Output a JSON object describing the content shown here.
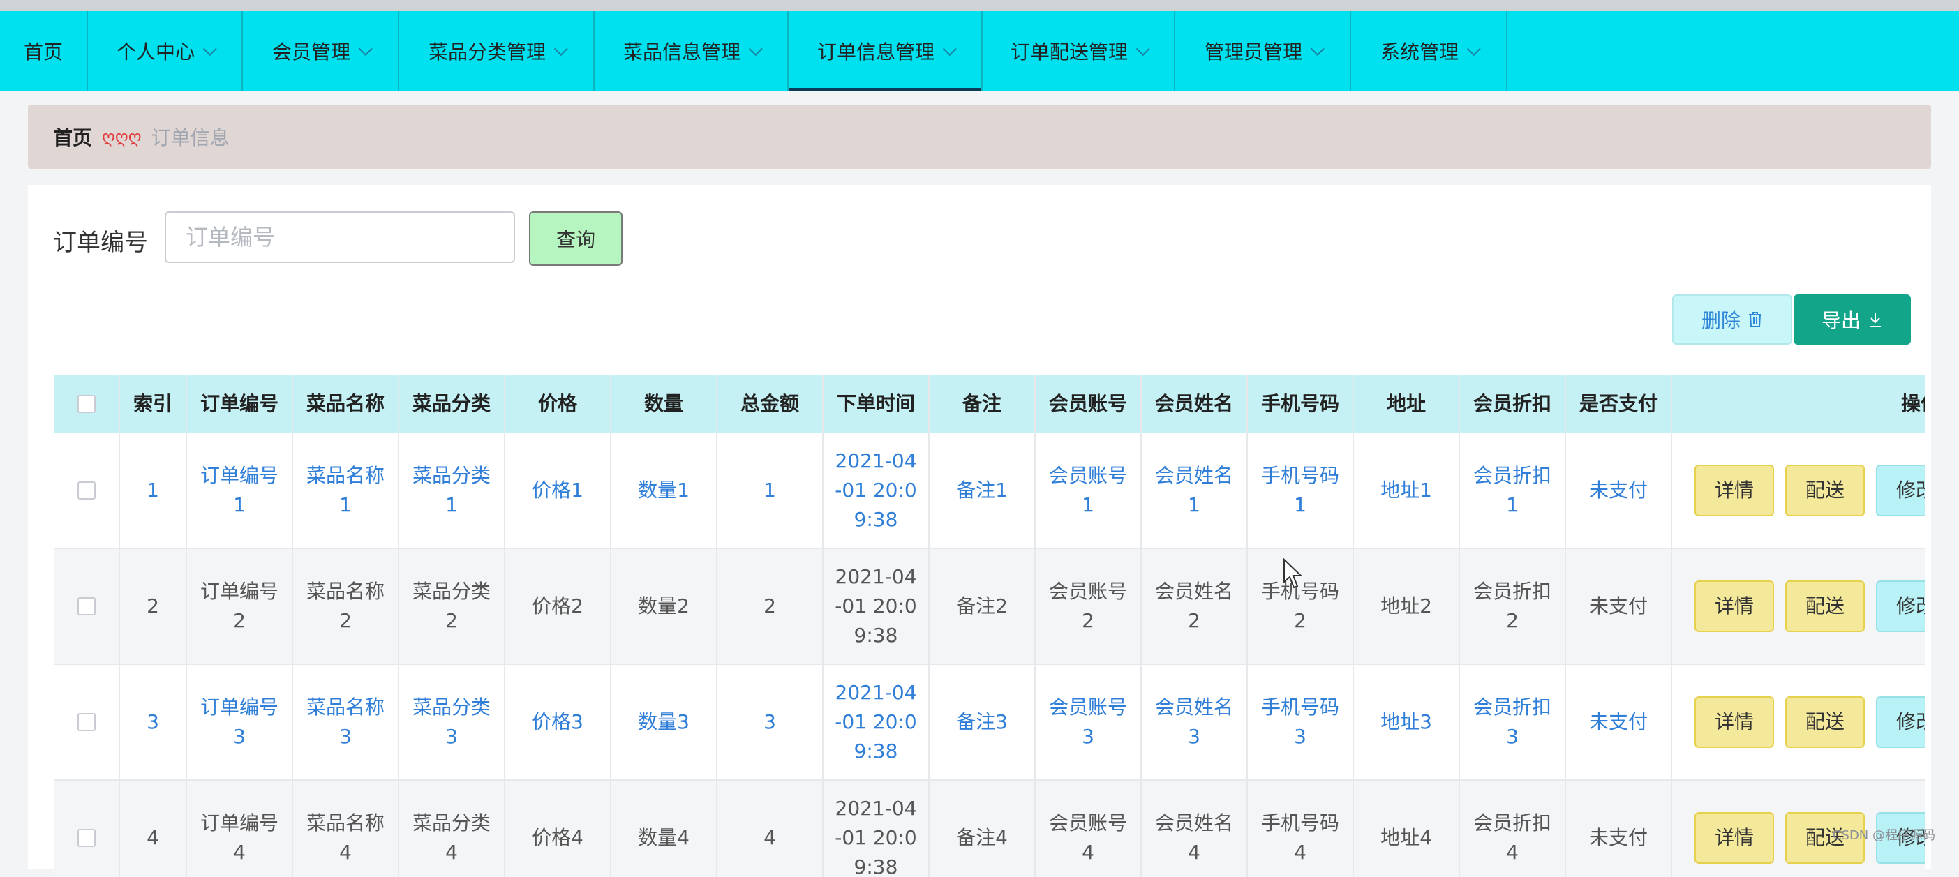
{
  "nav": {
    "items": [
      {
        "label": "首页",
        "dropdown": false
      },
      {
        "label": "个人中心",
        "dropdown": true
      },
      {
        "label": "会员管理",
        "dropdown": true
      },
      {
        "label": "菜品分类管理",
        "dropdown": true
      },
      {
        "label": "菜品信息管理",
        "dropdown": true
      },
      {
        "label": "订单信息管理",
        "dropdown": true,
        "active": true
      },
      {
        "label": "订单配送管理",
        "dropdown": true
      },
      {
        "label": "管理员管理",
        "dropdown": true
      },
      {
        "label": "系统管理",
        "dropdown": true
      }
    ]
  },
  "breadcrumb": {
    "home": "首页",
    "separator": "ღღღ",
    "current": "订单信息"
  },
  "search": {
    "label": "订单编号",
    "placeholder": "订单编号",
    "button": "查询"
  },
  "toolbar": {
    "delete_label": "删除",
    "export_label": "导出"
  },
  "table": {
    "headers": [
      "索引",
      "订单编号",
      "菜品名称",
      "菜品分类",
      "价格",
      "数量",
      "总金额",
      "下单时间",
      "备注",
      "会员账号",
      "会员姓名",
      "手机号码",
      "地址",
      "会员折扣",
      "是否支付",
      "操作"
    ],
    "action_labels": {
      "detail": "详情",
      "ship": "配送",
      "edit": "修改"
    },
    "rows": [
      [
        "1",
        "订单编号1",
        "菜品名称1",
        "菜品分类1",
        "价格1",
        "数量1",
        "1",
        "2021-04-01 20:09:38",
        "备注1",
        "会员账号1",
        "会员姓名1",
        "手机号码1",
        "地址1",
        "会员折扣1",
        "未支付"
      ],
      [
        "2",
        "订单编号2",
        "菜品名称2",
        "菜品分类2",
        "价格2",
        "数量2",
        "2",
        "2021-04-01 20:09:38",
        "备注2",
        "会员账号2",
        "会员姓名2",
        "手机号码2",
        "地址2",
        "会员折扣2",
        "未支付"
      ],
      [
        "3",
        "订单编号3",
        "菜品名称3",
        "菜品分类3",
        "价格3",
        "数量3",
        "3",
        "2021-04-01 20:09:38",
        "备注3",
        "会员账号3",
        "会员姓名3",
        "手机号码3",
        "地址3",
        "会员折扣3",
        "未支付"
      ],
      [
        "4",
        "订单编号4",
        "菜品名称4",
        "菜品分类4",
        "价格4",
        "数量4",
        "4",
        "2021-04-01 20:09:38",
        "备注4",
        "会员账号4",
        "会员姓名4",
        "手机号码4",
        "地址4",
        "会员折扣4",
        "未支付"
      ]
    ]
  },
  "watermark": "CSDN @程序源码",
  "colors": {
    "nav_bg": "#00e1f0",
    "header_bg": "#c6f1f4",
    "link_blue": "#2f7ed8",
    "export_green": "#13a58a"
  }
}
